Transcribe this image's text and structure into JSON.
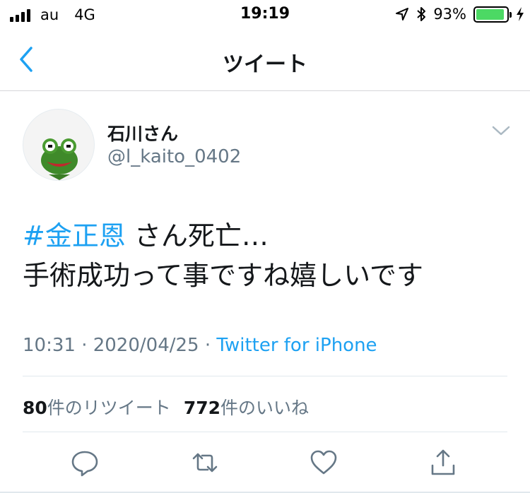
{
  "status_bar": {
    "carrier": "au",
    "network": "4G",
    "time": "19:19",
    "battery_percent": "93%",
    "battery_level": 0.93,
    "battery_color": "#4cd964",
    "icons": [
      "signal-icon",
      "location-arrow-icon",
      "bluetooth-icon",
      "battery-icon",
      "charging-bolt-icon"
    ]
  },
  "nav": {
    "title": "ツイート",
    "back_icon": "chevron-left-icon"
  },
  "tweet": {
    "display_name": "石川さん",
    "handle": "@l_kaito_0402",
    "avatar": "frog-avatar",
    "text_hashtag": "#金正恩",
    "text_line1_rest": " さん死亡…",
    "text_line2": "手術成功って事ですね嬉しいです",
    "time_date": "10:31 · 2020/04/25 · ",
    "source": "Twitter for iPhone"
  },
  "stats": {
    "retweets_count": "80",
    "retweets_label": "件のリツイート",
    "likes_count": "772",
    "likes_label": "件のいいね"
  },
  "actions": [
    "reply-icon",
    "retweet-icon",
    "like-icon",
    "share-icon"
  ],
  "colors": {
    "accent": "#1da1f2",
    "secondary_text": "#657786",
    "primary_text": "#14171a"
  }
}
